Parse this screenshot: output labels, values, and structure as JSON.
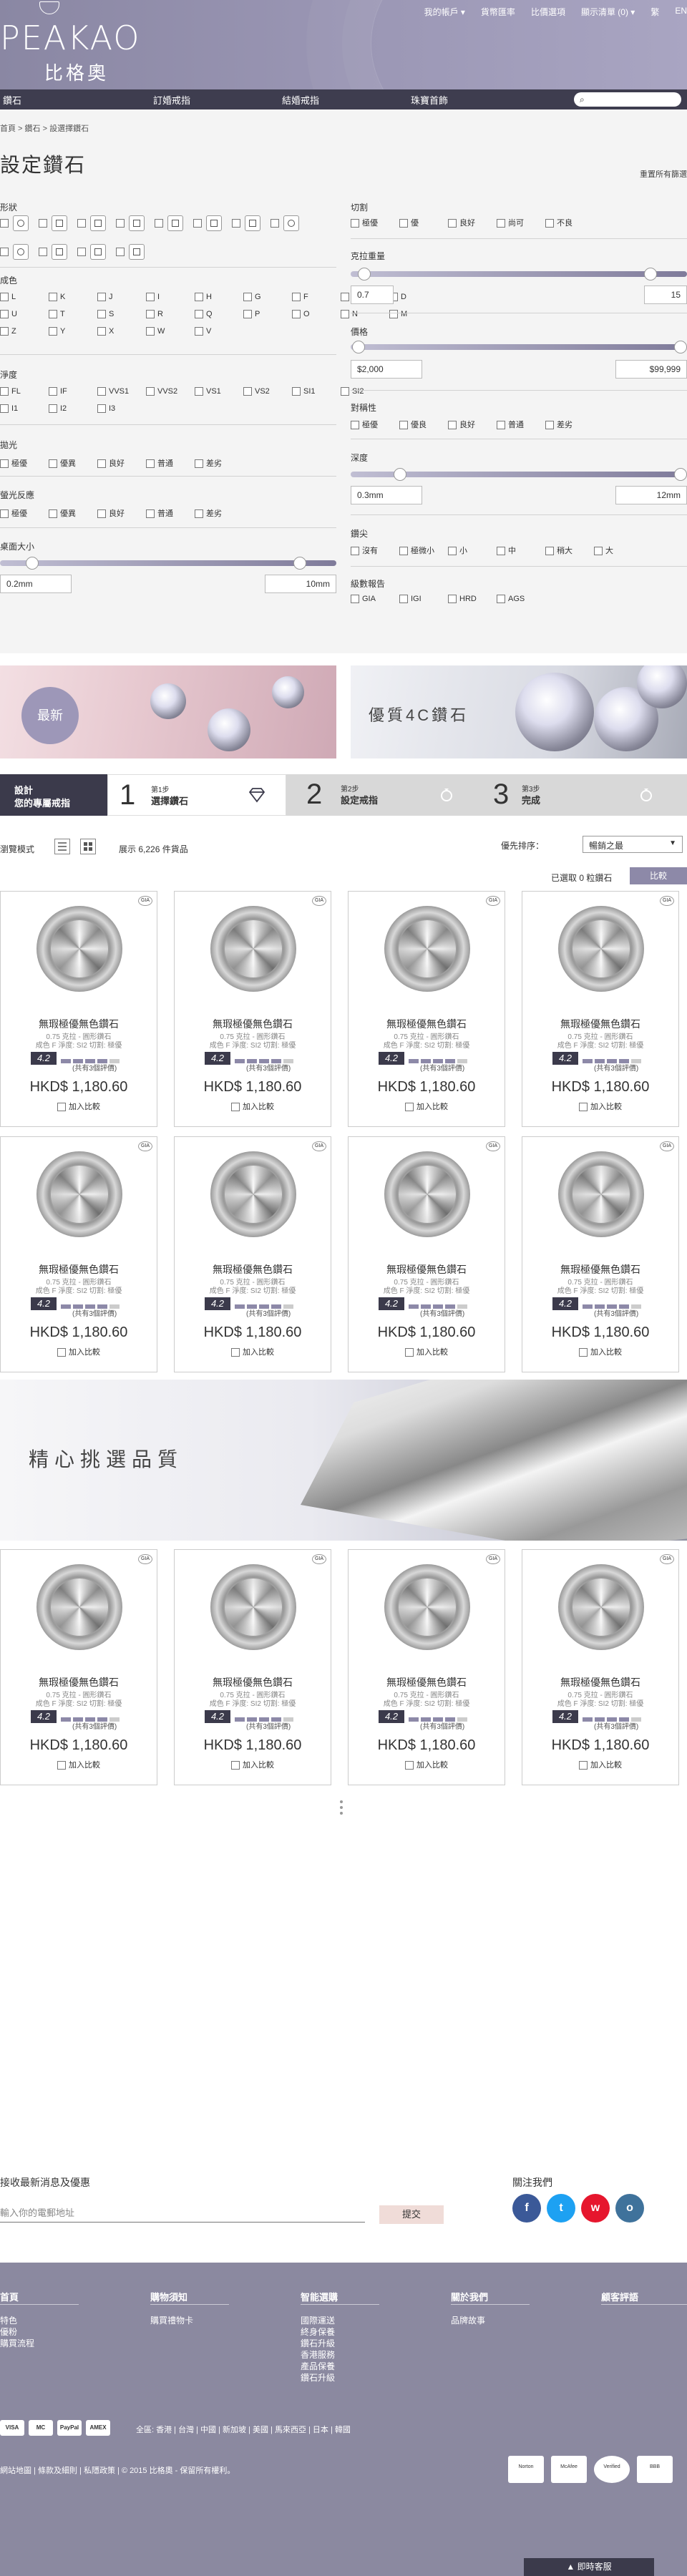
{
  "header": {
    "logo_en": "PEAKAO",
    "logo_zh": "比格奧",
    "links": [
      "我的帳戶 ▾",
      "貨幣匯率",
      "比價選項",
      "顯示清單 (0) ▾",
      "繁",
      "EN"
    ]
  },
  "nav": {
    "items": [
      "鑽石",
      "訂婚戒指",
      "結婚戒指",
      "珠寶首飾"
    ],
    "search_placeholder": ""
  },
  "filters": {
    "breadcrumb": "首頁 > 鑽石 > 設選擇鑽石",
    "title": "設定鑽石",
    "reset": "重置所有篩選",
    "shape_label": "形狀",
    "color_label": "成色",
    "colors": [
      "L",
      "K",
      "J",
      "I",
      "H",
      "G",
      "F",
      "E",
      "D",
      "U",
      "T",
      "S",
      "R",
      "Q",
      "P",
      "O",
      "N",
      "M",
      "Z",
      "Y",
      "X",
      "W",
      "V"
    ],
    "clarity_label": "淨度",
    "clarity": [
      "FL",
      "IF",
      "VVS1",
      "VVS2",
      "VS1",
      "VS2",
      "SI1",
      "SI2",
      "I1",
      "I2",
      "I3"
    ],
    "polish_label": "拋光",
    "fluor_label": "螢光反應",
    "grade_opts": [
      "極優",
      "優異",
      "良好",
      "普通",
      "差劣"
    ],
    "table_label": "桌面大小",
    "table_min": "0.2mm",
    "table_max": "10mm",
    "cut_label": "切割",
    "cut_opts": [
      "極優",
      "優",
      "良好",
      "尚可",
      "不良"
    ],
    "carat_label": "克拉重量",
    "carat_min": "0.7",
    "carat_max": "15",
    "price_label": "價格",
    "price_min": "$2,000",
    "price_max": "$99,999",
    "symmetry_label": "對稱性",
    "symmetry_opts": [
      "極優",
      "優良",
      "良好",
      "普通",
      "差劣"
    ],
    "depth_label": "深度",
    "depth_min": "0.3mm",
    "depth_max": "12mm",
    "culet_label": "鑽尖",
    "culet_opts": [
      "沒有",
      "極微小",
      "小",
      "中",
      "稍大",
      "大"
    ],
    "report_label": "級數報告",
    "report_opts": [
      "GIA",
      "IGI",
      "HRD",
      "AGS"
    ]
  },
  "banners": {
    "new": "最新",
    "fourc": "優質4C鑽石"
  },
  "steps": {
    "intro_line1": "設計",
    "intro_line2": "您的專屬戒指",
    "items": [
      {
        "num": "1",
        "small": "第1步",
        "title": "選擇鑽石"
      },
      {
        "num": "2",
        "small": "第2步",
        "title": "設定戒指"
      },
      {
        "num": "3",
        "small": "第3步",
        "title": "完成"
      }
    ]
  },
  "toolbar": {
    "view_mode": "瀏覽模式",
    "showing": "展示 6,226 件貨品",
    "sort_label": "優先排序：",
    "sort_value": "暢銷之最",
    "selected": "已選取 0 粒鑽石",
    "compare": "比較"
  },
  "product": {
    "badge": "GIA",
    "name": "無瑕極優無色鑽石",
    "spec1": "0.75 克拉 - 圓形鑽石",
    "spec2": "成色 F  淨度: SI2  切割: 極優",
    "rating": "4.2",
    "rating_level": 0.8,
    "reviews": "(共有3個評價)",
    "price": "HKD$ 1,180.60",
    "compare": "加入比較"
  },
  "mid_banner": "精心挑選品質",
  "newsletter": {
    "title": "接收最新消息及優惠",
    "placeholder": "輸入你的電郵地址",
    "submit": "提交",
    "follow": "關注我們",
    "social": [
      "f",
      "t",
      "w",
      "o"
    ]
  },
  "footer": {
    "cols": [
      {
        "head": "首頁",
        "links": [
          "特色",
          "優粉",
          "購買流程"
        ]
      },
      {
        "head": "購物須知",
        "links": [
          "購買禮物卡"
        ]
      },
      {
        "head": "智能選購",
        "links": [
          "國際運送",
          "終身保養",
          "鑽石升級",
          "香港服務",
          "產品保養",
          "鑽石升級"
        ]
      },
      {
        "head": "關於我們",
        "links": [
          "品牌故事"
        ]
      },
      {
        "head": "顧客評語",
        "links": []
      }
    ],
    "payments": [
      "VISA",
      "MC",
      "PayPal",
      "AMEX"
    ],
    "regions": "全區: 香港 | 台灣 | 中國 | 新加坡 | 美國 | 馬來西亞 | 日本 | 韓國",
    "copyright": "網站地圖 | 條款及細則 | 私隱政策 | © 2015 比格奧 - 保留所有權利。",
    "certs": [
      "Norton",
      "McAfee",
      "Verified",
      "BBB"
    ],
    "chat": "▲  即時客服"
  },
  "colors": {
    "header": "#9a96b4",
    "nav": "#3e3d4f",
    "accent": "#8d89a8",
    "footer": "#8b89a0"
  }
}
